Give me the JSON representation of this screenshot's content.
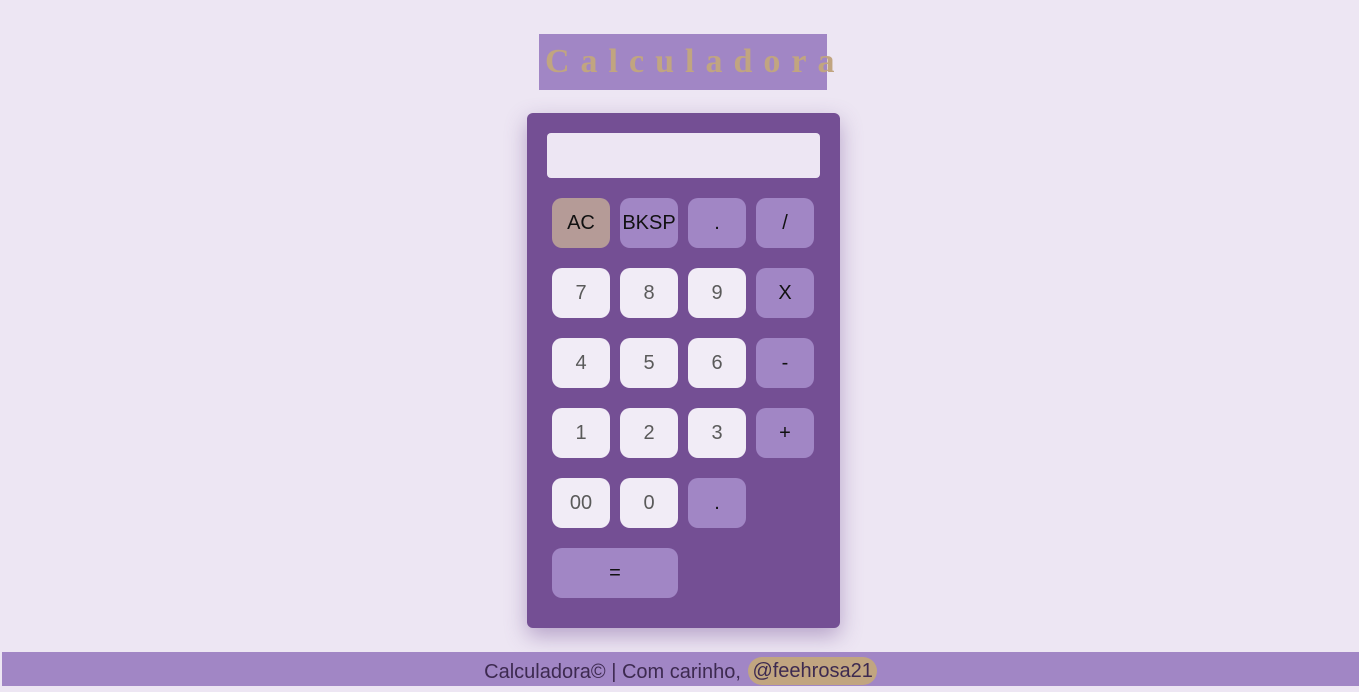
{
  "header": {
    "title": "Calculadora"
  },
  "calculator": {
    "display": {
      "value": "",
      "placeholder": ""
    },
    "keys": {
      "ac": "AC",
      "bksp": "BKSP",
      "dot_top": ".",
      "divide": "/",
      "seven": "7",
      "eight": "8",
      "nine": "9",
      "multiply": "X",
      "four": "4",
      "five": "5",
      "six": "6",
      "minus": "-",
      "one": "1",
      "two": "2",
      "three": "3",
      "plus": "+",
      "double_zero": "00",
      "zero": "0",
      "dot_bottom": ".",
      "equals": "="
    }
  },
  "footer": {
    "text": "Calculadora© | Com carinho, ",
    "handle": "@feehrosa21"
  },
  "colors": {
    "page_background": "#ede6f3",
    "calculator_body": "#744f94",
    "accent_lavender": "#a186c5",
    "accent_gold": "#c1a580",
    "clear_key": "#b59b97"
  }
}
